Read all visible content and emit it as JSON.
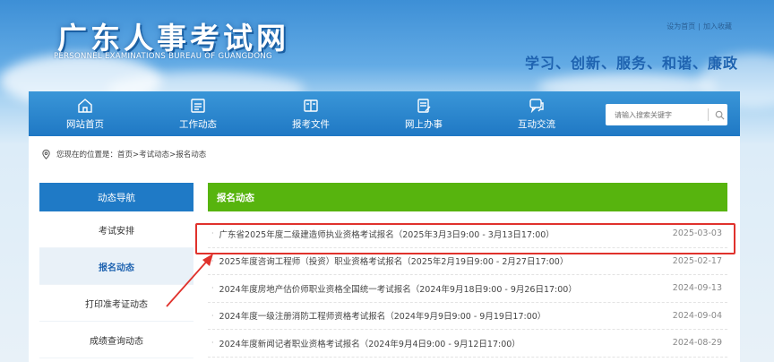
{
  "header": {
    "logo_main": "广东人事考试网",
    "logo_sub": "PERSONNEL EXAMINATIONS BUREAU OF GUANGDONG",
    "top_links": [
      "设为首页",
      "加入收藏"
    ],
    "slogan": "学习、创新、服务、和谐、廉政"
  },
  "nav": {
    "items": [
      {
        "label": "网站首页",
        "icon": "home-icon"
      },
      {
        "label": "工作动态",
        "icon": "calendar-icon"
      },
      {
        "label": "报考文件",
        "icon": "book-icon"
      },
      {
        "label": "网上办事",
        "icon": "document-edit-icon"
      },
      {
        "label": "互动交流",
        "icon": "chat-icon"
      }
    ],
    "search_placeholder": "请输入搜索关键字"
  },
  "breadcrumb": {
    "text": "您现在的位置是：首页>考试动态>报名动态"
  },
  "sidebar": {
    "title": "动态导航",
    "items": [
      {
        "label": "考试安排",
        "active": false
      },
      {
        "label": "报名动态",
        "active": true
      },
      {
        "label": "打印准考证动态",
        "active": false
      },
      {
        "label": "成绩查询动态",
        "active": false
      }
    ]
  },
  "main": {
    "title": "报名动态",
    "news": [
      {
        "title": "广东省2025年度二级建造师执业资格考试报名（2025年3月3日9:00 - 3月13日17:00）",
        "date": "2025-03-03"
      },
      {
        "title": "2025年度咨询工程师（投资）职业资格考试报名（2025年2月19日9:00 - 2月27日17:00）",
        "date": "2025-02-17"
      },
      {
        "title": "2024年度房地产估价师职业资格全国统一考试报名（2024年9月18日9:00 - 9月26日17:00）",
        "date": "2024-09-13"
      },
      {
        "title": "2024年度一级注册消防工程师资格考试报名（2024年9月9日9:00 - 9月19日17:00）",
        "date": "2024-09-04"
      },
      {
        "title": "2024年度新闻记者职业资格考试报名（2024年9月4日9:00 - 9月12日17:00）",
        "date": "2024-08-29"
      }
    ]
  },
  "colors": {
    "nav_bg": "#1f7ac6",
    "section_head": "#57b40e",
    "highlight": "#e0322c",
    "slogan": "#1f63b0"
  }
}
